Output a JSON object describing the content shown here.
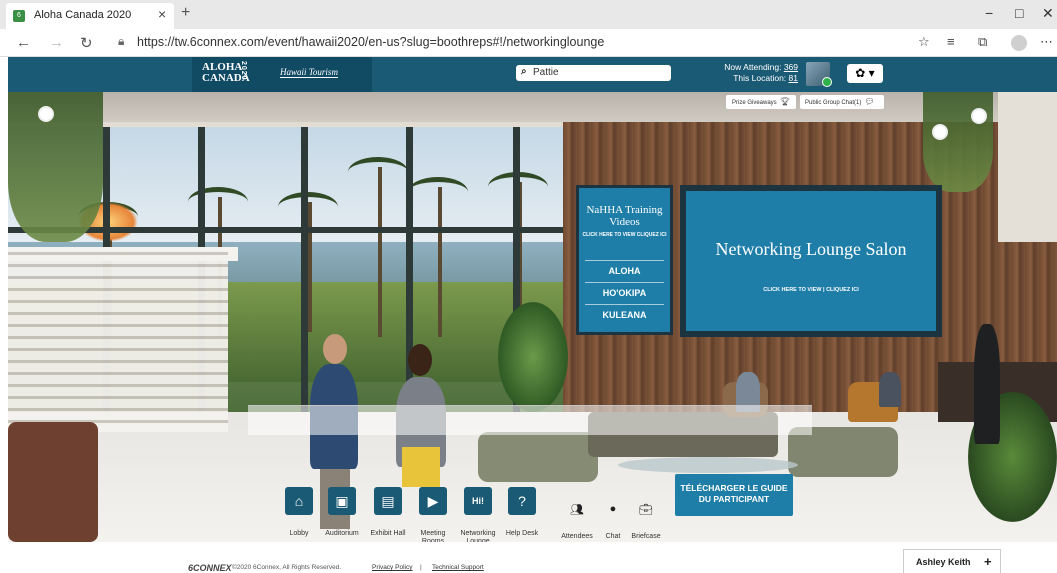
{
  "browser": {
    "tab_title": "Aloha Canada 2020",
    "tab_close": "×",
    "new_tab": "+",
    "url": "https://tw.6connex.com/event/hawaii2020/en-us?slug=boothreps#!/networkinglounge",
    "window_controls": {
      "minimize": "−",
      "maximize": "□",
      "close": "✕"
    },
    "nav": {
      "back": "←",
      "forward": "→",
      "refresh": "↻"
    }
  },
  "header": {
    "logo_line1": "ALOHA",
    "logo_line2": "CANADA",
    "logo_year": "2020",
    "hawaii_logo": "Hawaii Tourism",
    "search_value": "Pattie",
    "now_attending_label": "Now Attending:",
    "now_attending_value": "369",
    "this_location_label": "This Location:",
    "this_location_value": "81",
    "settings_label": "✿ ▾"
  },
  "scene": {
    "prize_label": "Prize Giveaways",
    "chat_label": "Public Group Chat(1)",
    "nahha": {
      "title": "NaHHA Training Videos",
      "subtitle": "CLICK HERE TO VIEW CLIQUEZ ICI",
      "links": [
        "ALOHA",
        "HO'OKIPA",
        "KULEANA"
      ]
    },
    "lounge": {
      "title": "Networking Lounge Salon",
      "subtitle": "CLICK HERE TO VIEW | CLIQUEZ ICI"
    },
    "guide_button": "TÉLÉCHARGER LE GUIDE DU PARTICIPANT"
  },
  "bottom_nav": {
    "items": [
      {
        "label": "Lobby",
        "icon": "house-icon"
      },
      {
        "label": "Auditorium",
        "icon": "presentation-icon"
      },
      {
        "label": "Exhibit Hall",
        "icon": "booth-icon"
      },
      {
        "label": "Meeting Rooms",
        "icon": "play-icon"
      },
      {
        "label": "Networking Lounge",
        "icon": "hi-bubble-icon"
      },
      {
        "label": "Help Desk",
        "icon": "headset-icon"
      }
    ],
    "small_items": [
      {
        "label": "Attendees",
        "icon": "people-icon"
      },
      {
        "label": "Chat",
        "icon": "chat-icon"
      },
      {
        "label": "Briefcase",
        "icon": "briefcase-icon"
      }
    ]
  },
  "footer": {
    "brand": "6CONNEX",
    "copyright": "©2020 6Connex, All Rights Reserved.",
    "separator": "|",
    "privacy": "Privacy Policy",
    "technical": "Technical Support"
  },
  "chat_user": {
    "name": "Ashley Keith",
    "plus": "+"
  },
  "colors": {
    "header_bg": "#1b5a74",
    "screen_blue": "#1e7ea8",
    "nav_icon_bg": "#1b5a74"
  }
}
